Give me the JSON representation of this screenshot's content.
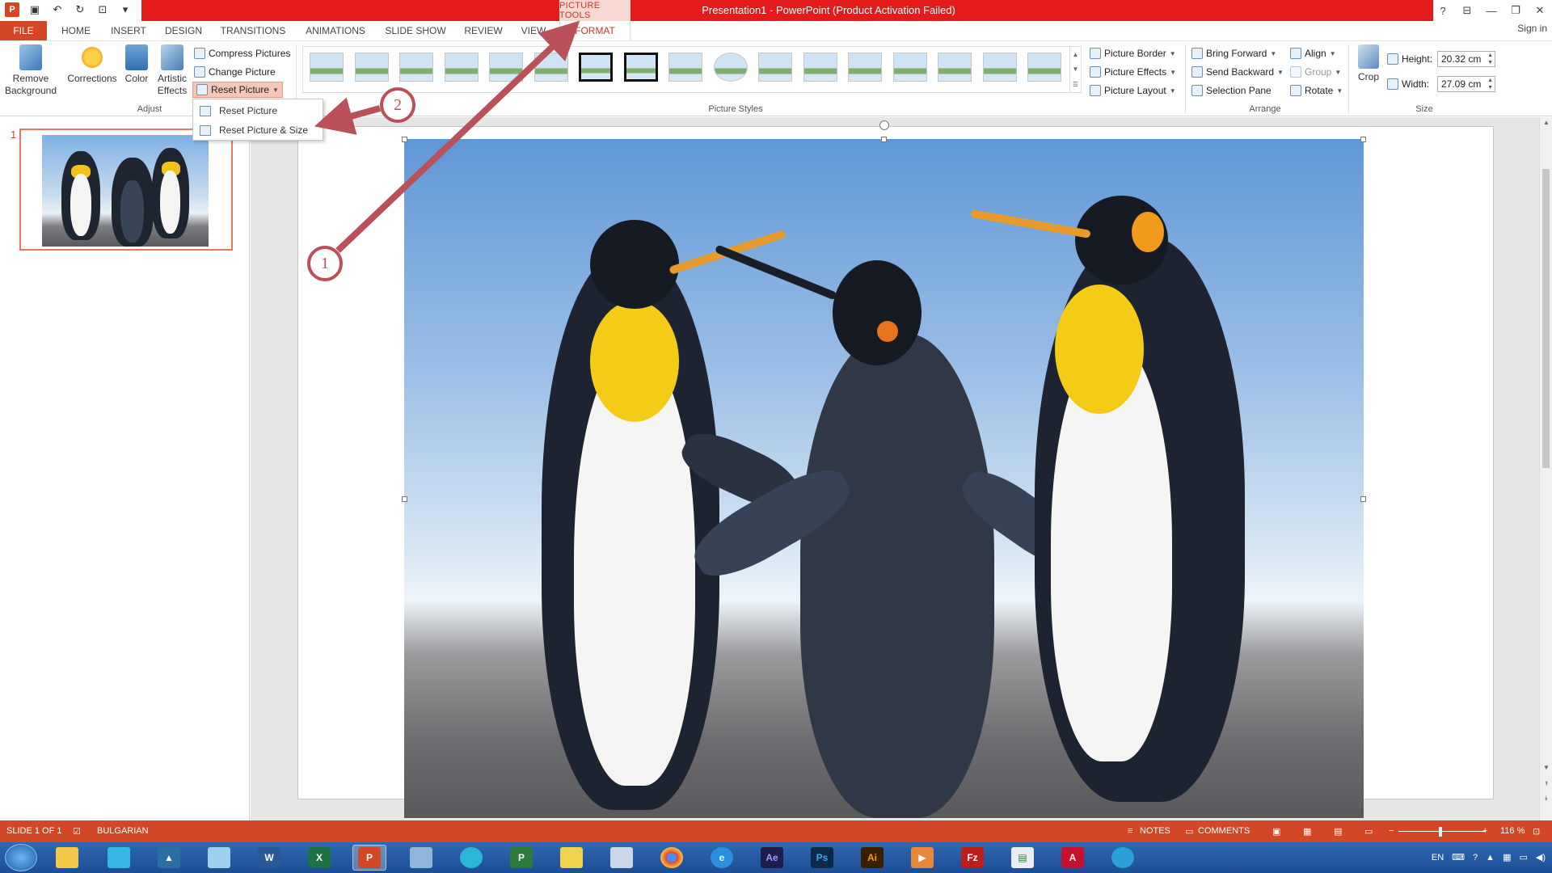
{
  "window": {
    "title": "Presentation1 -  PowerPoint (Product Activation Failed)",
    "contextual_group": "PICTURE TOOLS",
    "controls": [
      "?",
      "❐",
      "—",
      "❐",
      "✕"
    ]
  },
  "quick_access": {
    "app_icon": "P",
    "icons": [
      "save-icon",
      "undo-icon",
      "redo-icon",
      "presentation-icon",
      "customize-icon"
    ]
  },
  "tabs": {
    "file": "FILE",
    "home": "HOME",
    "insert": "INSERT",
    "design": "DESIGN",
    "transitions": "TRANSITIONS",
    "animations": "ANIMATIONS",
    "slideshow": "SLIDE SHOW",
    "review": "REVIEW",
    "view": "VIEW",
    "format": "FORMAT",
    "signin": "Sign in"
  },
  "ribbon": {
    "adjust": {
      "label": "Adjust",
      "remove_background": "Remove Background",
      "corrections": "Corrections",
      "color": "Color",
      "artistic_effects": "Artistic Effects",
      "compress": "Compress Pictures",
      "change": "Change Picture",
      "reset": "Reset Picture"
    },
    "styles": {
      "label": "Picture Styles",
      "count": 17
    },
    "picture_options": {
      "border": "Picture Border",
      "effects": "Picture Effects",
      "layout": "Picture Layout"
    },
    "arrange": {
      "label": "Arrange",
      "bring_forward": "Bring Forward",
      "send_backward": "Send Backward",
      "selection_pane": "Selection Pane",
      "align": "Align",
      "group": "Group",
      "rotate": "Rotate"
    },
    "size": {
      "label": "Size",
      "crop": "Crop",
      "height_label": "Height:",
      "height_value": "20.32 cm",
      "width_label": "Width:",
      "width_value": "27.09 cm"
    }
  },
  "dropdown": {
    "items": [
      "Reset Picture",
      "Reset Picture & Size"
    ]
  },
  "slides_pane": {
    "slide_number": "1"
  },
  "annotations": {
    "one": "1",
    "two": "2"
  },
  "status": {
    "slide": "SLIDE 1 OF 1",
    "language": "BULGARIAN",
    "notes": "NOTES",
    "comments": "COMMENTS",
    "zoom": "116 %"
  },
  "taskbar": {
    "apps": [
      "explorer",
      "recycle",
      "autocad",
      "notepad",
      "W",
      "X",
      "P",
      "calculator",
      "arrows",
      "P",
      "folder",
      "paint",
      "chrome",
      "e",
      "Ae",
      "Ps",
      "Ai",
      "media",
      "Fz",
      "sheet",
      "acrobat",
      "chat"
    ],
    "tray_lang": "EN"
  },
  "colors": {
    "accent": "#d24726",
    "title_red": "#e31b1b",
    "annotation": "#b9505a",
    "taskbar": "#1d4d93"
  }
}
